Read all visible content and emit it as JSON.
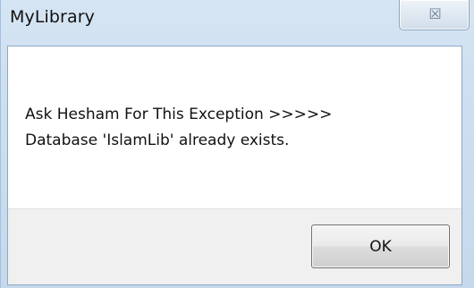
{
  "window": {
    "title": "MyLibrary",
    "close_glyph": "☒"
  },
  "message": {
    "line1": "Ask Hesham For This Exception >>>>>",
    "line2": "Database 'IslamLib' already exists."
  },
  "buttons": {
    "ok_label": "OK"
  },
  "icons": {
    "close": "close-icon"
  }
}
